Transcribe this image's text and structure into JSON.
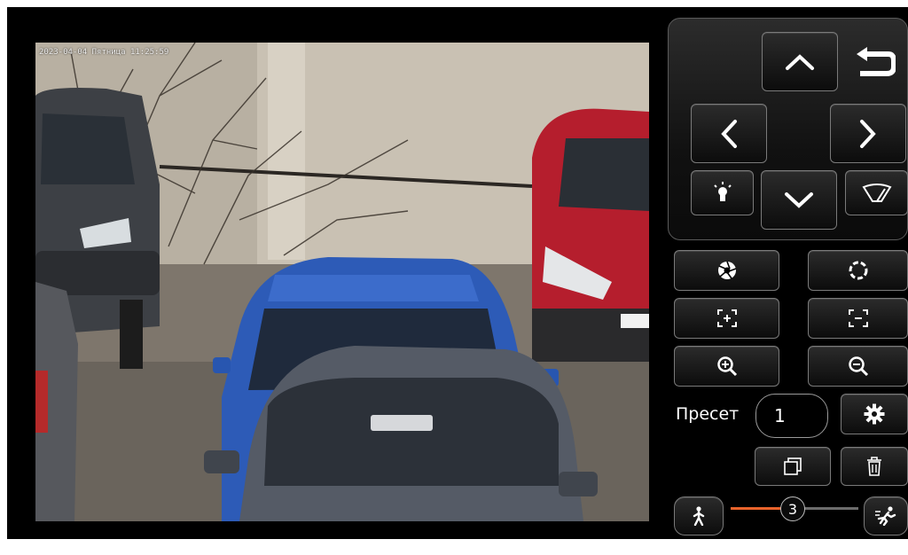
{
  "video": {
    "osd_timestamp": "2023-04-04 Пятница 11:25:59"
  },
  "ptz": {
    "buttons": [
      {
        "name": "tilt-up-button",
        "icon": "chevron-up-icon"
      },
      {
        "name": "home-return-button",
        "icon": "undo-arrow-icon"
      },
      {
        "name": "pan-left-button",
        "icon": "chevron-left-icon"
      },
      {
        "name": "pan-right-button",
        "icon": "chevron-right-icon"
      },
      {
        "name": "light-button",
        "icon": "light-bulb-icon"
      },
      {
        "name": "tilt-down-button",
        "icon": "chevron-down-icon"
      },
      {
        "name": "wiper-button",
        "icon": "wiper-icon"
      }
    ]
  },
  "lens": {
    "buttons": [
      {
        "name": "iris-open-button",
        "icon": "iris-open-icon"
      },
      {
        "name": "iris-close-button",
        "icon": "iris-close-icon"
      },
      {
        "name": "focus-near-button",
        "icon": "focus-plus-icon"
      },
      {
        "name": "focus-far-button",
        "icon": "focus-minus-icon"
      },
      {
        "name": "zoom-in-button",
        "icon": "zoom-in-icon"
      },
      {
        "name": "zoom-out-button",
        "icon": "zoom-out-icon"
      }
    ]
  },
  "preset": {
    "label": "Пресет",
    "value": "1"
  },
  "speed": {
    "value": "3",
    "level_fraction": 0.4,
    "slow_icon": "walking-person-icon",
    "fast_icon": "running-person-icon"
  },
  "colors": {
    "accent": "#e8632b",
    "panel": "#000000",
    "border": "#7a7a7a"
  }
}
